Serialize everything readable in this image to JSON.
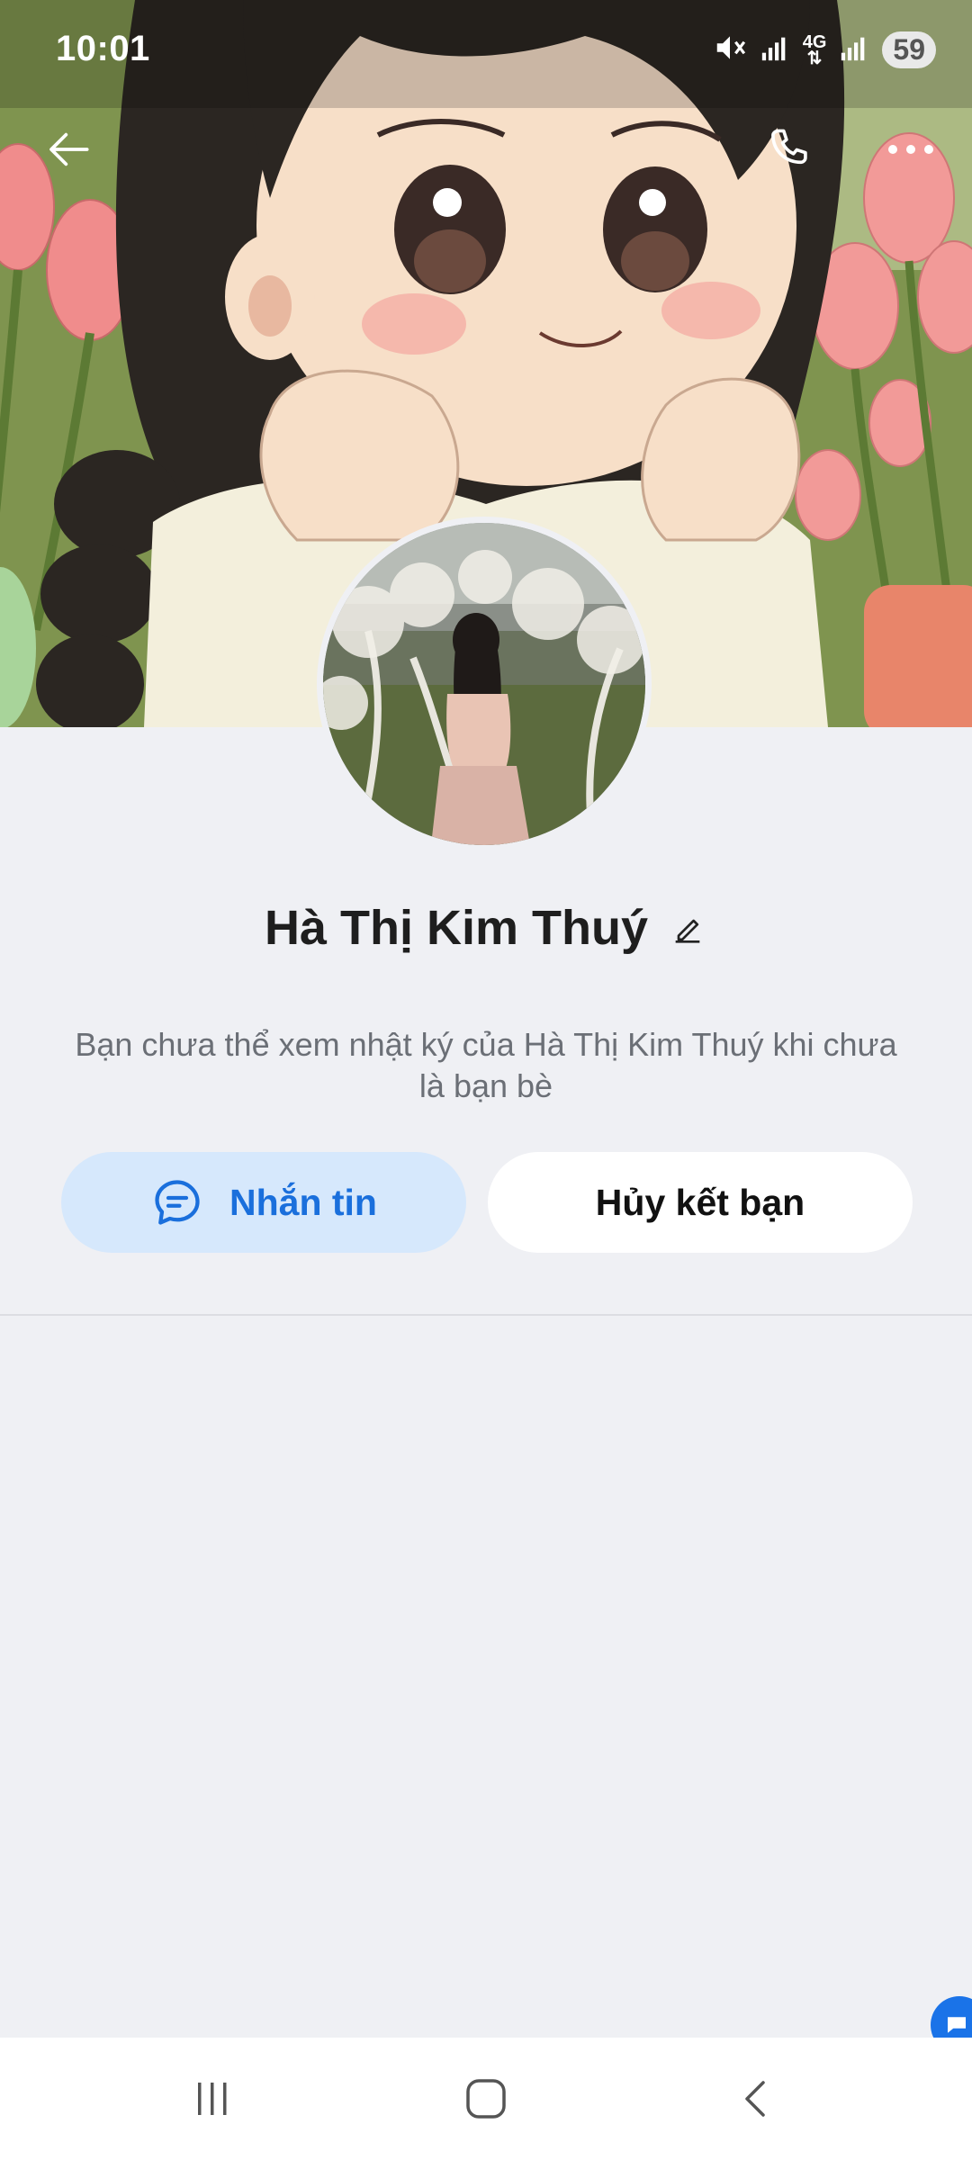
{
  "status_bar": {
    "time": "10:01",
    "battery": "59",
    "network": "4G",
    "icons": [
      "mute-icon",
      "signal-icon",
      "4g-icon",
      "signal-icon",
      "battery-icon"
    ]
  },
  "header": {
    "back_icon": "back-arrow-icon",
    "call_icon": "phone-icon",
    "more_icon": "more-dots-icon"
  },
  "profile": {
    "name": "Hà Thị Kim Thuý",
    "edit_icon": "pencil-icon",
    "notice": "Bạn chưa thể xem nhật ký của Hà Thị Kim Thuý khi chưa là bạn bè"
  },
  "actions": {
    "message_label": "Nhắn tin",
    "message_icon": "chat-bubble-icon",
    "unfriend_label": "Hủy kết bạn"
  },
  "nav": {
    "recent_icon": "recent-apps-icon",
    "home_icon": "home-icon",
    "back_icon": "back-icon"
  },
  "colors": {
    "accent": "#1a6fdc",
    "message_bg": "#d6e8fc",
    "page_bg": "#eff0f4"
  }
}
